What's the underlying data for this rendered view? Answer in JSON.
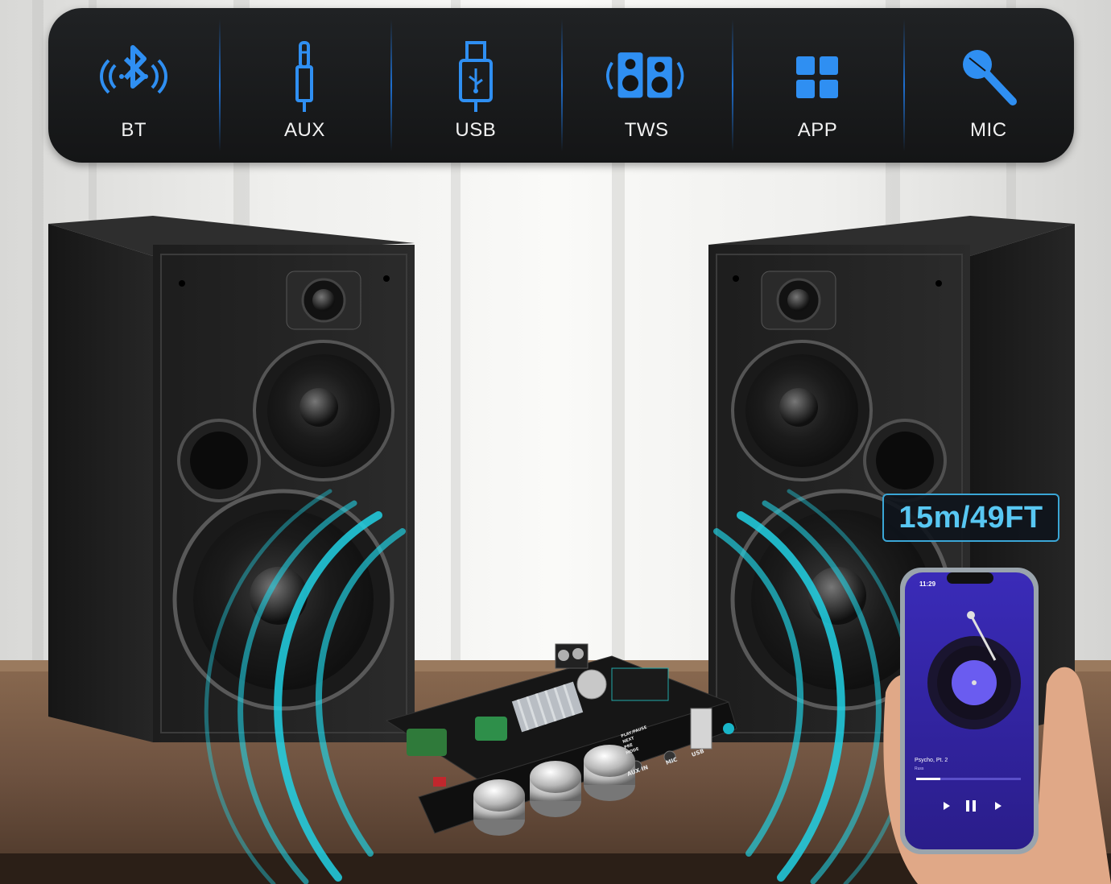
{
  "features": [
    {
      "label": "BT",
      "icon": "bluetooth-icon"
    },
    {
      "label": "AUX",
      "icon": "aux-jack-icon"
    },
    {
      "label": "USB",
      "icon": "usb-icon"
    },
    {
      "label": "TWS",
      "icon": "tws-speakers-icon"
    },
    {
      "label": "APP",
      "icon": "app-grid-icon"
    },
    {
      "label": "MIC",
      "icon": "microphone-icon"
    }
  ],
  "range": "15m/49FT",
  "phone": {
    "time": "11:29",
    "song_title": "Psycho, Pt. 2",
    "artist": "Russ"
  },
  "board_labels": {
    "aux": "AUX IN",
    "mic": "MIC",
    "usb": "USB",
    "buttons": [
      "PLAY/PAUSE",
      "NEXT",
      "PRE",
      "MODE"
    ]
  },
  "colors": {
    "accent": "#2f8ff2",
    "wave": "#22d3e6",
    "bar_bg": "#1a1b1c"
  }
}
